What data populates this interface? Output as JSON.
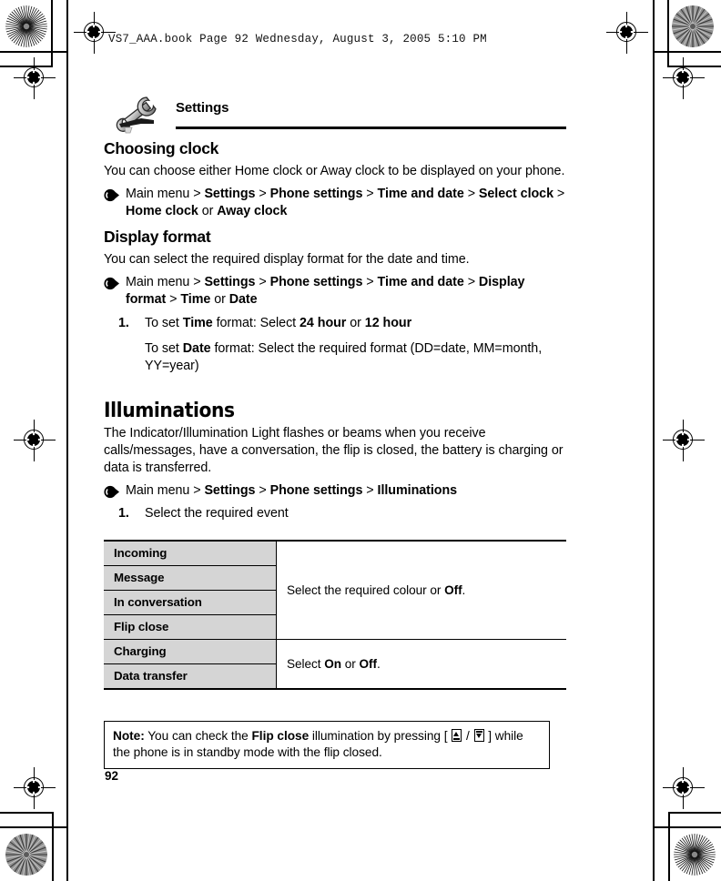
{
  "print_header": "VS7_AAA.book  Page 92  Wednesday, August 3, 2005  5:10 PM",
  "chapter": {
    "icon": "wrench-icon",
    "title": "Settings"
  },
  "sections": [
    {
      "heading": "Choosing clock",
      "body": "You can choose either Home clock or Away clock to be displayed on your phone.",
      "path_icon": "arrow-bullet-icon",
      "path": [
        {
          "t": "Main menu",
          "b": false
        },
        {
          "t": " > ",
          "b": false
        },
        {
          "t": "Settings",
          "b": true
        },
        {
          "t": " > ",
          "b": false
        },
        {
          "t": "Phone settings",
          "b": true
        },
        {
          "t": " > ",
          "b": false
        },
        {
          "t": "Time and date",
          "b": true
        },
        {
          "t": " > ",
          "b": false
        },
        {
          "t": "Select clock",
          "b": true
        },
        {
          "t": " > ",
          "b": false
        },
        {
          "t": "Home clock",
          "b": true
        },
        {
          "t": " or ",
          "b": false
        },
        {
          "t": "Away clock",
          "b": true
        }
      ]
    },
    {
      "heading": "Display format",
      "body": "You can select the required display format for the date and time.",
      "path_icon": "arrow-bullet-icon",
      "path": [
        {
          "t": "Main menu",
          "b": false
        },
        {
          "t": " > ",
          "b": false
        },
        {
          "t": "Settings",
          "b": true
        },
        {
          "t": " > ",
          "b": false
        },
        {
          "t": "Phone settings",
          "b": true
        },
        {
          "t": " > ",
          "b": false
        },
        {
          "t": "Time and date",
          "b": true
        },
        {
          "t": " > ",
          "b": false
        },
        {
          "t": "Display format",
          "b": true
        },
        {
          "t": " > ",
          "b": false
        },
        {
          "t": "Time",
          "b": true
        },
        {
          "t": " or ",
          "b": false
        },
        {
          "t": "Date",
          "b": true
        }
      ],
      "step_number": "1.",
      "step": [
        {
          "t": "To set ",
          "b": false
        },
        {
          "t": "Time",
          "b": true
        },
        {
          "t": " format: Select ",
          "b": false
        },
        {
          "t": "24 hour",
          "b": true
        },
        {
          "t": " or ",
          "b": false
        },
        {
          "t": "12 hour",
          "b": true
        }
      ],
      "step_sub": [
        {
          "t": "To set ",
          "b": false
        },
        {
          "t": "Date",
          "b": true
        },
        {
          "t": " format: Select the required format (DD=date, MM=month, YY=year)",
          "b": false
        }
      ]
    }
  ],
  "illuminations": {
    "heading": "Illuminations",
    "body": "The Indicator/Illumination Light flashes or beams when you receive calls/messages, have a conversation, the flip is closed, the battery is charging or data is transferred.",
    "path_icon": "arrow-bullet-icon",
    "path": [
      {
        "t": "Main menu",
        "b": false
      },
      {
        "t": " > ",
        "b": false
      },
      {
        "t": "Settings",
        "b": true
      },
      {
        "t": " > ",
        "b": false
      },
      {
        "t": "Phone settings",
        "b": true
      },
      {
        "t": " > ",
        "b": false
      },
      {
        "t": "Illuminations",
        "b": true
      }
    ],
    "step_number": "1.",
    "step": [
      {
        "t": "Select the required event",
        "b": false
      }
    ],
    "table": {
      "groups": [
        {
          "labels": [
            "Incoming",
            "Message",
            "In conversation",
            "Flip close"
          ],
          "value": [
            {
              "t": "Select the required colour or ",
              "b": false
            },
            {
              "t": "Off",
              "b": true
            },
            {
              "t": ".",
              "b": false
            }
          ]
        },
        {
          "labels": [
            "Charging",
            "Data transfer"
          ],
          "value": [
            {
              "t": "Select ",
              "b": false
            },
            {
              "t": "On",
              "b": true
            },
            {
              "t": " or ",
              "b": false
            },
            {
              "t": "Off",
              "b": true
            },
            {
              "t": ".",
              "b": false
            }
          ]
        }
      ]
    }
  },
  "note": {
    "label": "Note:",
    "parts": [
      {
        "t": " You can check the ",
        "b": false
      },
      {
        "t": "Flip close",
        "b": true
      },
      {
        "t": " illumination by pressing [ ",
        "b": false
      },
      {
        "t": "KEY_UP",
        "b": false,
        "glyph": "side-key-up-icon"
      },
      {
        "t": " / ",
        "b": false
      },
      {
        "t": "KEY_DOWN",
        "b": false,
        "glyph": "side-key-down-icon"
      },
      {
        "t": " ] while the phone is in standby mode with the flip closed.",
        "b": false
      }
    ]
  },
  "page_number": "92",
  "colors": {
    "table_label_bg": "#d5d5d5",
    "rule": "#000000",
    "page_bg": "#ffffff"
  }
}
